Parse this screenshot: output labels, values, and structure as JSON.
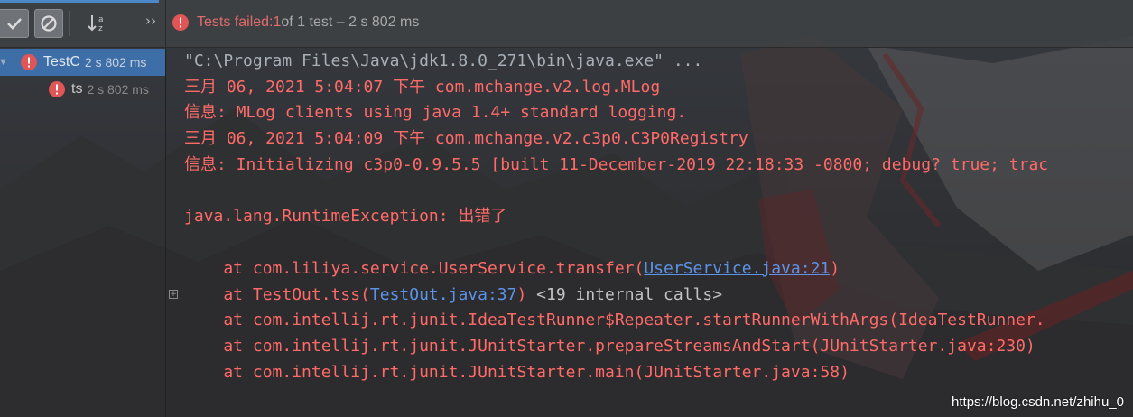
{
  "toolbar": {
    "buttons": [
      {
        "name": "show-passed",
        "icon": "check-icon",
        "pressed": true
      },
      {
        "name": "show-ignored",
        "icon": "stop-icon",
        "pressed": true
      },
      {
        "name": "sort-alphabetically",
        "icon": "sort-alpha-icon",
        "pressed": false
      }
    ],
    "overflow_icon": "double-chevron-right-icon",
    "status": {
      "prefix": "Tests failed: ",
      "failed_count": "1",
      "rest": " of 1 test – 2 s 802 ms"
    }
  },
  "tree": {
    "items": [
      {
        "name": "TestC",
        "time": "2 s 802 ms",
        "status": "failed",
        "expanded": true,
        "selected": true
      },
      {
        "name": "ts",
        "time": "2 s 802 ms",
        "status": "failed",
        "selected": false
      }
    ]
  },
  "console": {
    "lines": [
      {
        "text": "\"C:\\Program Files\\Java\\jdk1.8.0_271\\bin\\java.exe\" ..."
      },
      {
        "text": "三月 06, 2021 5:04:07 下午 com.mchange.v2.log.MLog"
      },
      {
        "text": "信息: MLog clients using java 1.4+ standard logging."
      },
      {
        "text": "三月 06, 2021 5:04:09 下午 com.mchange.v2.c3p0.C3P0Registry"
      },
      {
        "text": "信息: Initializing c3p0-0.9.5.5 [built 11-December-2019 22:18:33 -0800; debug? true; trac"
      },
      {
        "text": "java.lang.RuntimeException: 出错了"
      },
      {
        "prefix": "    at com.liliya.service.UserService.transfer(",
        "link": "UserService.java:21",
        "suffix": ")"
      },
      {
        "prefix": "    at TestOut.tss(",
        "link": "TestOut.java:37",
        "suffix": ") ",
        "extra": "<19 internal calls>"
      },
      {
        "text": "    at com.intellij.rt.junit.IdeaTestRunner$Repeater.startRunnerWithArgs(IdeaTestRunner."
      },
      {
        "text": "    at com.intellij.rt.junit.JUnitStarter.prepareStreamsAndStart(JUnitStarter.java:230)"
      },
      {
        "text": "    at com.intellij.rt.junit.JUnitStarter.main(JUnitStarter.java:58)"
      }
    ],
    "fold_icon": "expand-plus-icon"
  },
  "watermark": "https://blog.csdn.net/zhihu_0",
  "colors": {
    "error": "#ff6b68",
    "link": "#5c93e6",
    "selection": "#3d6ea8",
    "status_fail": "#e06c6c"
  }
}
